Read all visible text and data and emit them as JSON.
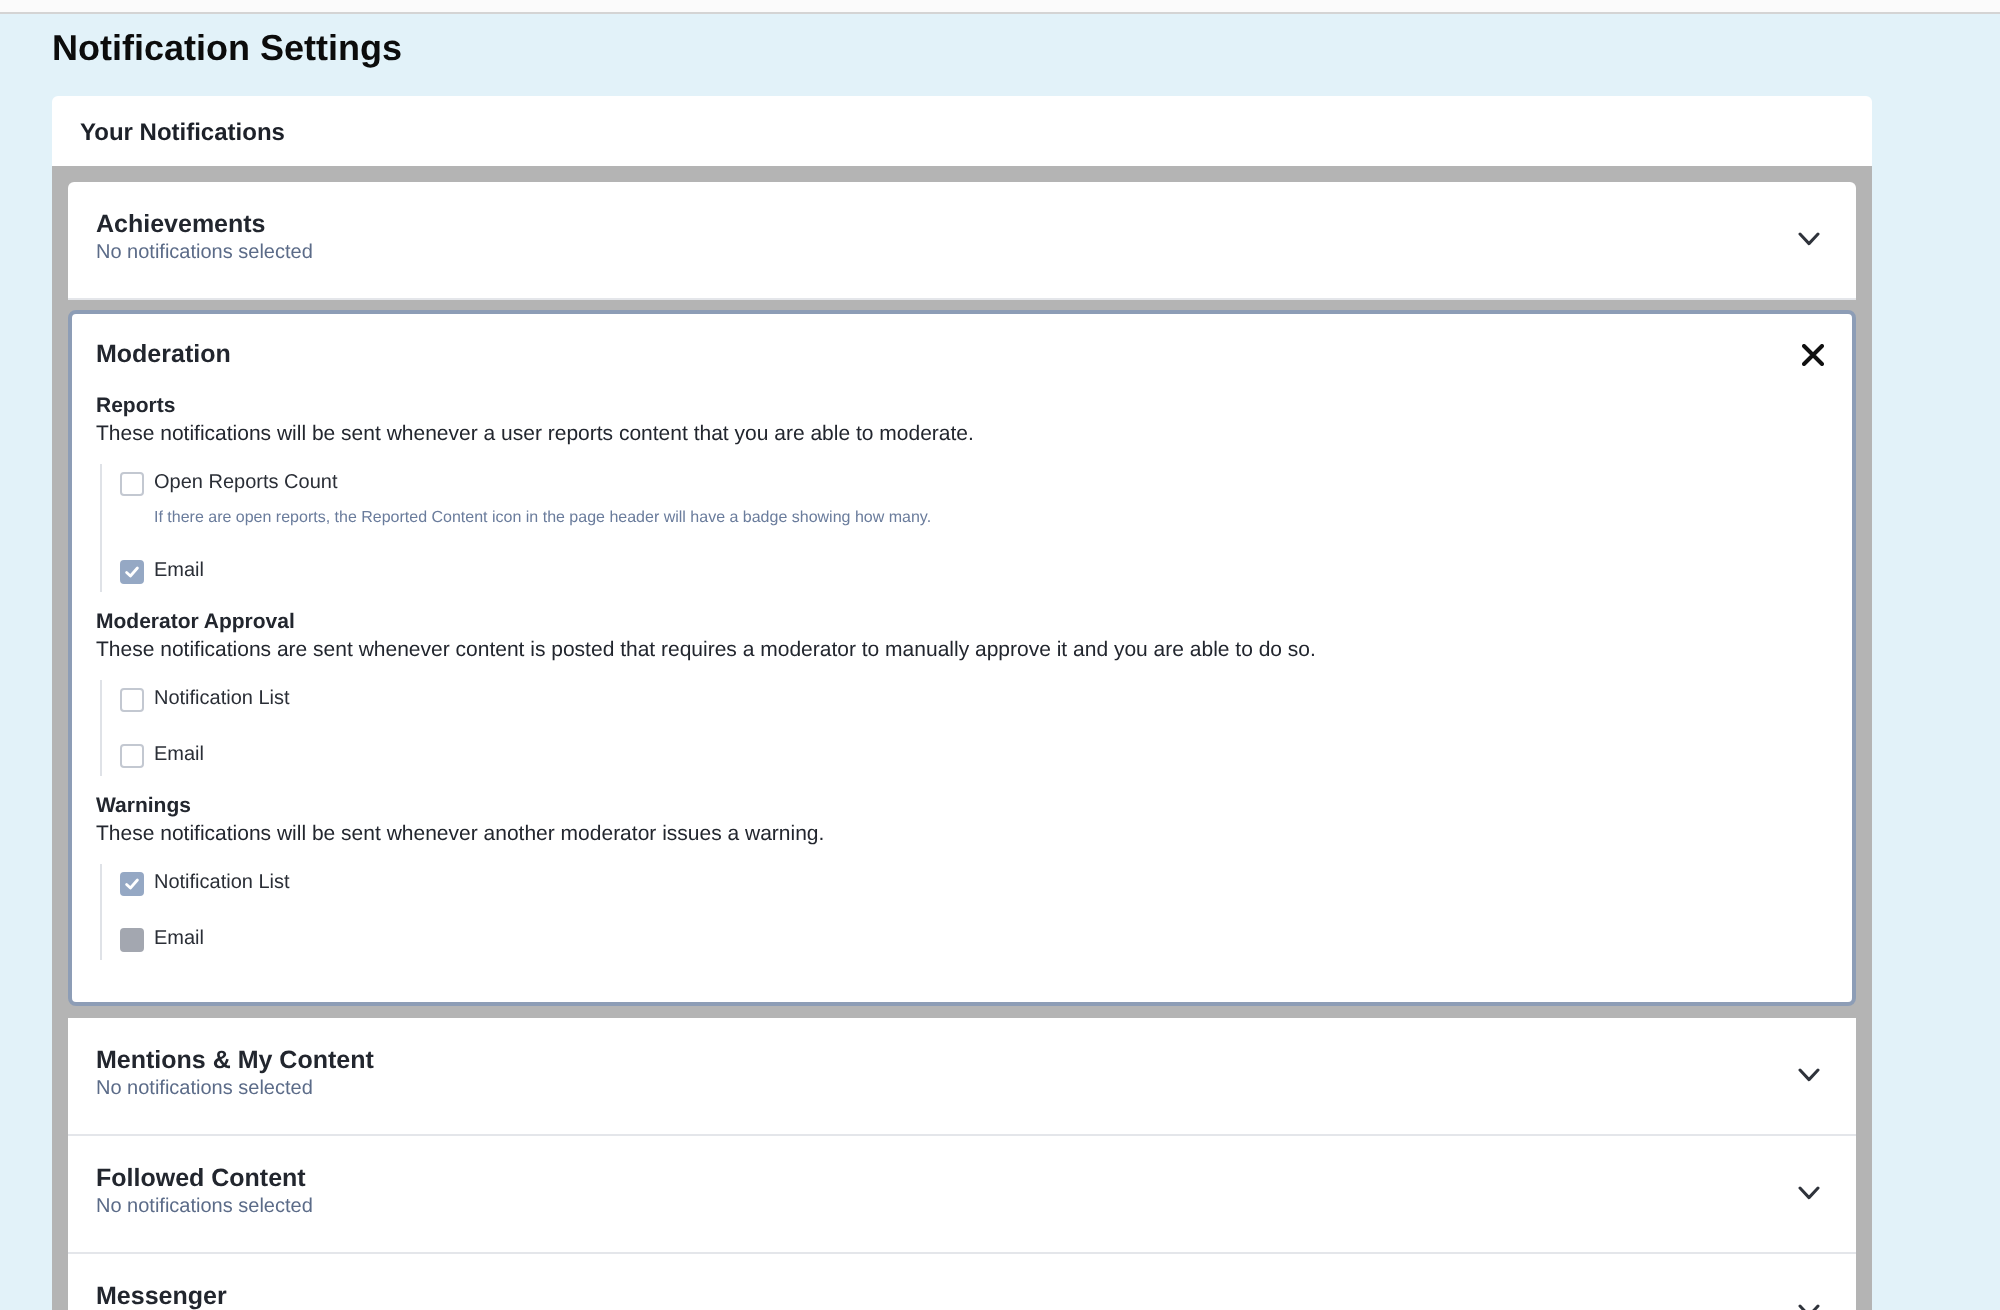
{
  "page": {
    "title": "Notification Settings"
  },
  "panel": {
    "title": "Your Notifications"
  },
  "sections": [
    {
      "title": "Achievements",
      "summary": "No notifications selected",
      "expanded": false
    },
    {
      "title": "Moderation",
      "expanded": true,
      "groups": [
        {
          "title": "Reports",
          "description": "These notifications will be sent whenever a user reports content that you are able to moderate.",
          "options": [
            {
              "label": "Open Reports Count",
              "hint": "If there are open reports, the Reported Content icon in the page header will have a badge showing how many.",
              "checked": false,
              "disabled": false
            },
            {
              "label": "Email",
              "checked": true,
              "disabled": false
            }
          ]
        },
        {
          "title": "Moderator Approval",
          "description": "These notifications are sent whenever content is posted that requires a moderator to manually approve it and you are able to do so.",
          "options": [
            {
              "label": "Notification List",
              "checked": false,
              "disabled": false
            },
            {
              "label": "Email",
              "checked": false,
              "disabled": false
            }
          ]
        },
        {
          "title": "Warnings",
          "description": "These notifications will be sent whenever another moderator issues a warning.",
          "options": [
            {
              "label": "Notification List",
              "checked": true,
              "disabled": false
            },
            {
              "label": "Email",
              "checked": false,
              "disabled": true
            }
          ]
        }
      ]
    },
    {
      "title": "Mentions & My Content",
      "summary": "No notifications selected",
      "expanded": false
    },
    {
      "title": "Followed Content",
      "summary": "No notifications selected",
      "expanded": false
    },
    {
      "title": "Messenger",
      "expanded": false
    }
  ]
}
